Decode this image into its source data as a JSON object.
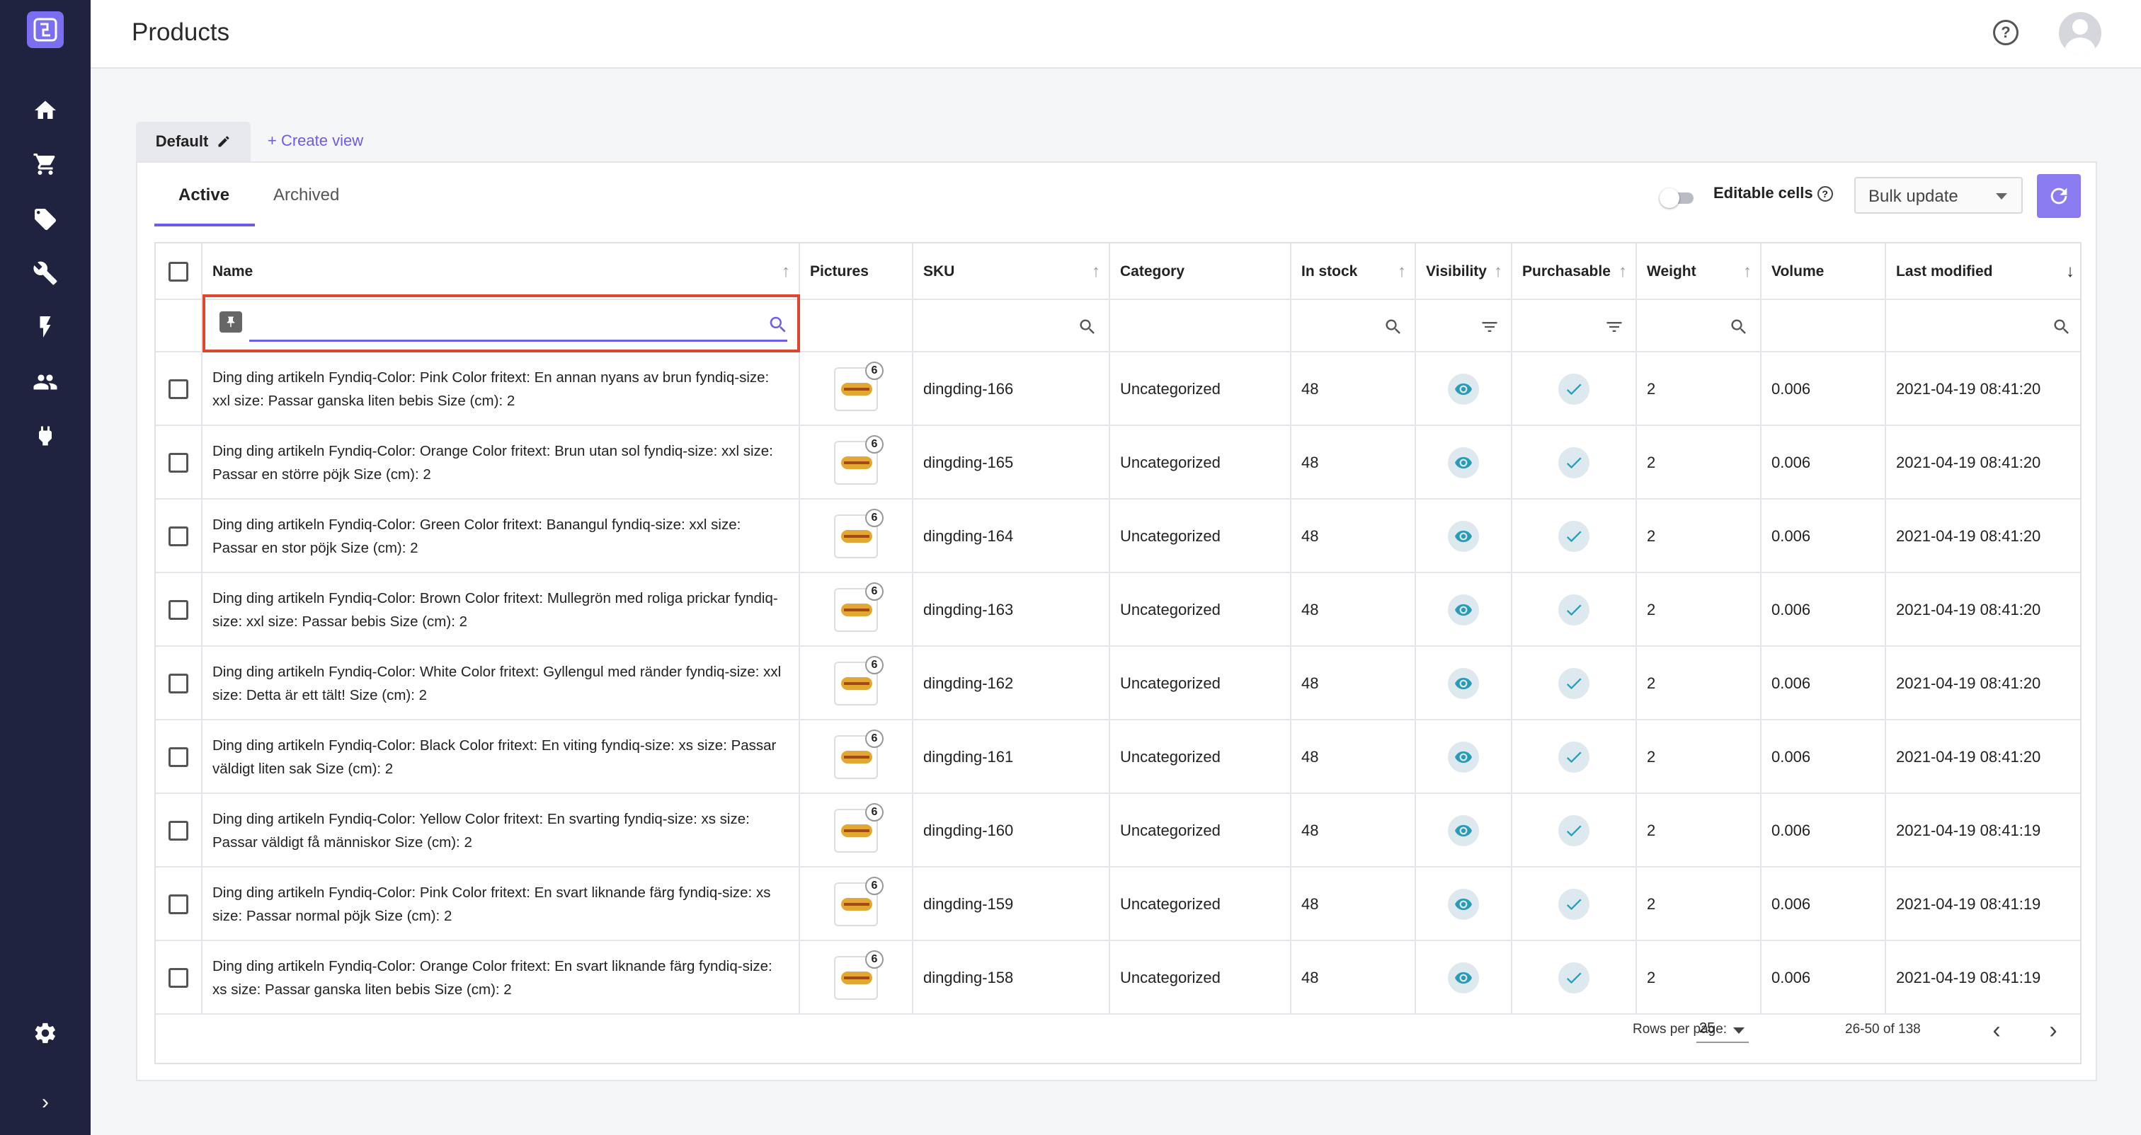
{
  "page": {
    "title": "Products"
  },
  "colors": {
    "accent": "#6c5ce7",
    "sidebar": "#1f2340",
    "icon_teal": "#2a9bb6",
    "highlight_border": "#e0452f"
  },
  "sidebar": {
    "logo": "app-logo-icon",
    "items": [
      "home-icon",
      "cart-icon",
      "tag-icon",
      "tools-icon",
      "bolt-icon",
      "users-icon",
      "plug-icon"
    ],
    "settings": "gear-icon",
    "expand": "›"
  },
  "header": {
    "help": "?"
  },
  "views": {
    "default_label": "Default",
    "create_label": "+ Create view"
  },
  "tabs": {
    "active": "Active",
    "archived": "Archived"
  },
  "toolbar": {
    "editable_label": "Editable cells",
    "editable_help": "?",
    "editable_on": false,
    "bulk_label": "Bulk update"
  },
  "table": {
    "columns": [
      "Name",
      "Pictures",
      "SKU",
      "Category",
      "In stock",
      "Visibility",
      "Purchasable",
      "Weight",
      "Volume",
      "Last modified"
    ],
    "rows": [
      {
        "name": "Ding ding artikeln Fyndiq-Color: Pink Color fritext: En annan nyans av brun fyndiq-size: xxl size: Passar ganska liten bebis Size (cm): 2",
        "pictures": "6",
        "sku": "dingding-166",
        "category": "Uncategorized",
        "stock": "48",
        "weight": "2",
        "volume": "0.006",
        "modified": "2021-04-19 08:41:20"
      },
      {
        "name": "Ding ding artikeln Fyndiq-Color: Orange Color fritext: Brun utan sol fyndiq-size: xxl size: Passar en större pöjk Size (cm): 2",
        "pictures": "6",
        "sku": "dingding-165",
        "category": "Uncategorized",
        "stock": "48",
        "weight": "2",
        "volume": "0.006",
        "modified": "2021-04-19 08:41:20"
      },
      {
        "name": "Ding ding artikeln Fyndiq-Color: Green Color fritext: Banangul fyndiq-size: xxl size: Passar en stor pöjk Size (cm): 2",
        "pictures": "6",
        "sku": "dingding-164",
        "category": "Uncategorized",
        "stock": "48",
        "weight": "2",
        "volume": "0.006",
        "modified": "2021-04-19 08:41:20"
      },
      {
        "name": "Ding ding artikeln Fyndiq-Color: Brown Color fritext: Mullegrön med roliga prickar fyndiq-size: xxl size: Passar bebis Size (cm): 2",
        "pictures": "6",
        "sku": "dingding-163",
        "category": "Uncategorized",
        "stock": "48",
        "weight": "2",
        "volume": "0.006",
        "modified": "2021-04-19 08:41:20"
      },
      {
        "name": "Ding ding artikeln Fyndiq-Color: White Color fritext: Gyllengul med ränder fyndiq-size: xxl size: Detta är ett tält! Size (cm): 2",
        "pictures": "6",
        "sku": "dingding-162",
        "category": "Uncategorized",
        "stock": "48",
        "weight": "2",
        "volume": "0.006",
        "modified": "2021-04-19 08:41:20"
      },
      {
        "name": "Ding ding artikeln Fyndiq-Color: Black Color fritext: En viting fyndiq-size: xs size: Passar väldigt liten sak Size (cm): 2",
        "pictures": "6",
        "sku": "dingding-161",
        "category": "Uncategorized",
        "stock": "48",
        "weight": "2",
        "volume": "0.006",
        "modified": "2021-04-19 08:41:20"
      },
      {
        "name": "Ding ding artikeln Fyndiq-Color: Yellow Color fritext: En svarting fyndiq-size: xs size: Passar väldigt få människor Size (cm): 2",
        "pictures": "6",
        "sku": "dingding-160",
        "category": "Uncategorized",
        "stock": "48",
        "weight": "2",
        "volume": "0.006",
        "modified": "2021-04-19 08:41:19"
      },
      {
        "name": "Ding ding artikeln Fyndiq-Color: Pink Color fritext: En svart liknande färg fyndiq-size: xs size: Passar normal pöjk Size (cm): 2",
        "pictures": "6",
        "sku": "dingding-159",
        "category": "Uncategorized",
        "stock": "48",
        "weight": "2",
        "volume": "0.006",
        "modified": "2021-04-19 08:41:19"
      },
      {
        "name": "Ding ding artikeln Fyndiq-Color: Orange Color fritext: En svart liknande färg fyndiq-size: xs size: Passar ganska liten bebis Size (cm): 2",
        "pictures": "6",
        "sku": "dingding-158",
        "category": "Uncategorized",
        "stock": "48",
        "weight": "2",
        "volume": "0.006",
        "modified": "2021-04-19 08:41:19"
      }
    ]
  },
  "pagination": {
    "rows_label": "Rows per page:",
    "rows_value": "25",
    "range": "26-50 of 138"
  }
}
